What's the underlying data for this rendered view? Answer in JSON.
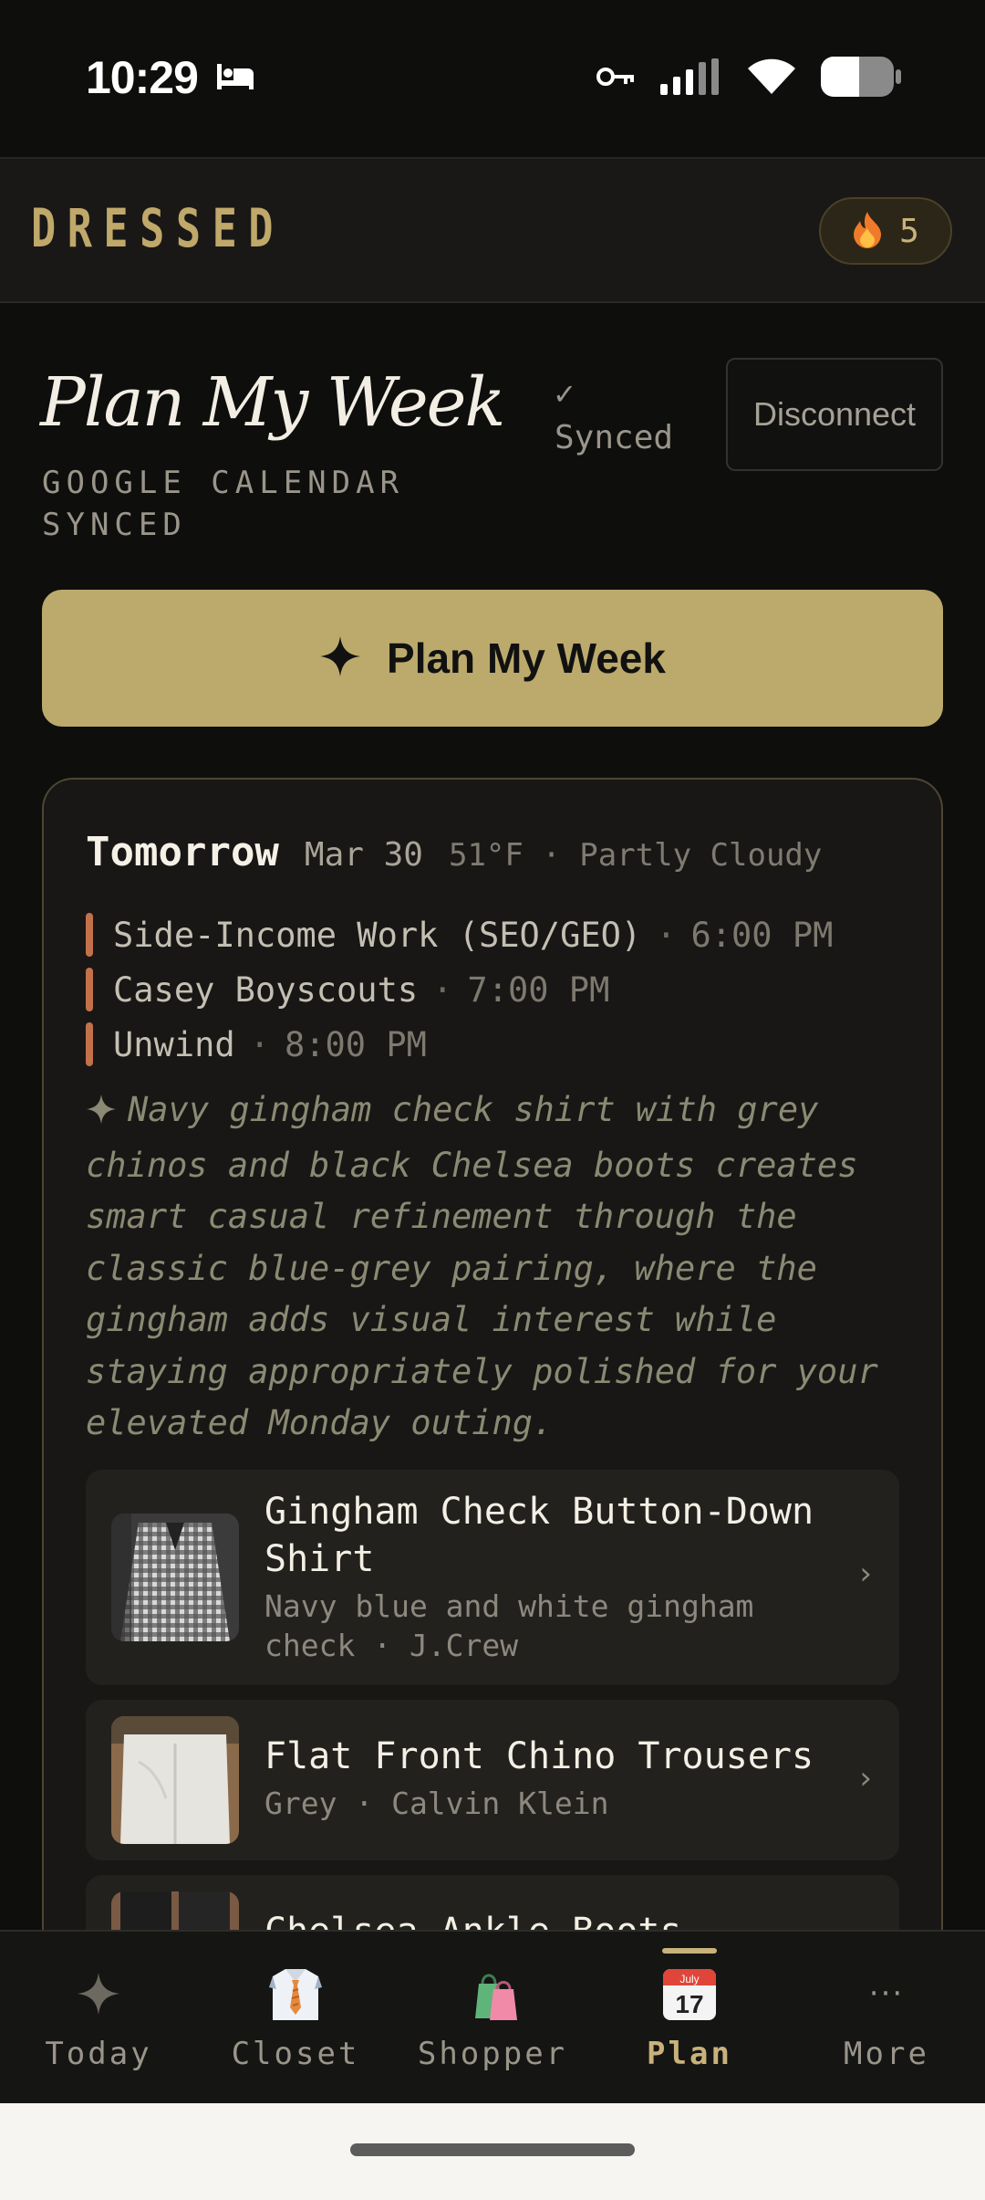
{
  "status_bar": {
    "time": "10:29"
  },
  "header": {
    "brand": "DRESSED",
    "streak_count": "5"
  },
  "plan_section": {
    "title": "Plan My Week",
    "subtitle": "GOOGLE CALENDAR SYNCED",
    "sync_status": "✓ Synced",
    "disconnect_label": "Disconnect",
    "plan_button_label": "Plan My Week"
  },
  "day_card": {
    "day": "Tomorrow",
    "date": "Mar 30",
    "weather": "51°F · Partly Cloudy",
    "events": [
      {
        "title": "Side-Income Work (SEO/GEO)",
        "time": "6:00 PM"
      },
      {
        "title": "Casey Boyscouts",
        "time": "7:00 PM"
      },
      {
        "title": "Unwind",
        "time": "8:00 PM"
      }
    ],
    "event_separator": "·",
    "rationale": "Navy gingham check shirt with grey chinos and black Chelsea boots creates smart casual refinement through the classic blue-grey pairing, where the gingham adds visual interest while staying appropriately polished for your elevated Monday outing.",
    "items": [
      {
        "name": "Gingham Check Button-Down Shirt",
        "meta": "Navy blue and white gingham check · J.Crew"
      },
      {
        "name": "Flat Front Chino Trousers",
        "meta": "Grey · Calvin Klein"
      },
      {
        "name": "Chelsea Ankle Boots",
        "meta": ""
      }
    ],
    "chevron": "›"
  },
  "bottom_nav": {
    "items": [
      {
        "label": "Today",
        "icon": "sparkle-icon"
      },
      {
        "label": "Closet",
        "icon": "shirt-tie-icon"
      },
      {
        "label": "Shopper",
        "icon": "shopping-bags-icon"
      },
      {
        "label": "Plan",
        "icon": "calendar-icon",
        "active": true
      },
      {
        "label": "More",
        "icon": "more-dots-icon"
      }
    ],
    "calendar_icon_month": "July",
    "calendar_icon_day": "17",
    "more_glyph": "···"
  },
  "colors": {
    "background": "#0e0e0d",
    "accent_gold": "#bcaa6c",
    "event_marker": "#c2714a",
    "rationale_text": "#8a8a74"
  }
}
